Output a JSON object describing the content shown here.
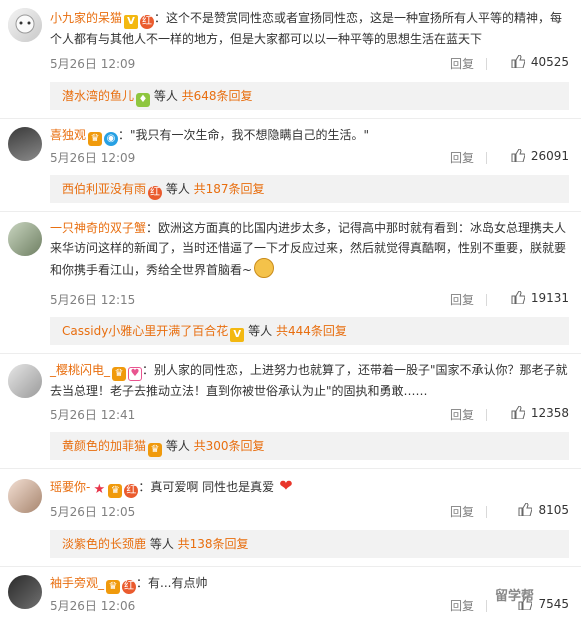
{
  "comments": [
    {
      "username": "小九家的呆猫",
      "text": "：这个不是赞赏同性恋或者宣扬同性恋，这是一种宣扬所有人平等的精神，每个人都有与其他人不一样的地方，但是大家都可以以一种平等的思想生活在蓝天下",
      "time": "5月26日 12:09",
      "reply_label": "回复",
      "likes": "40525",
      "replies": {
        "name": "潜水湾的鱼儿",
        "text": " 等人 ",
        "count": "共648条回复"
      }
    },
    {
      "username": "喜独观",
      "text": "：\"我只有一次生命，我不想隐瞒自己的生活。\"",
      "time": "5月26日 12:09",
      "reply_label": "回复",
      "likes": "26091",
      "replies": {
        "name": "西伯利亚没有雨",
        "text": " 等人 ",
        "count": "共187条回复"
      }
    },
    {
      "username": "一只神奇的双子蟹",
      "text": "：欧洲这方面真的比国内进步太多，记得高中那时就有看到：冰岛女总理携夫人来华访问这样的新闻了，当时还惜逼了一下才反应过来，然后就觉得真酷啊，性别不重要，朕就要和你携手看江山，秀给全世界首脑看~",
      "time": "5月26日 12:15",
      "reply_label": "回复",
      "likes": "19131",
      "replies": {
        "name": "Cassidy小雅心里开满了百合花",
        "text": " 等人 ",
        "count": "共444条回复"
      }
    },
    {
      "username": "_樱桃闪电_",
      "text": "：别人家的同性恋，上进努力也就算了，还带着一股子\"国家不承认你？那老子就去当总理！老子去推动立法！直到你被世俗承认为止\"的固执和勇敢……",
      "time": "5月26日 12:41",
      "reply_label": "回复",
      "likes": "12358",
      "replies": {
        "name": "黄颜色的加菲猫",
        "text": " 等人 ",
        "count": "共300条回复"
      }
    },
    {
      "username": "瑶要你-",
      "text": "：真可爱啊 同性也是真爱",
      "time": "5月26日 12:05",
      "reply_label": "回复",
      "likes": "8105",
      "replies": {
        "name": "淡紫色的长颈鹿",
        "text": " 等人 ",
        "count": "共138条回复"
      }
    },
    {
      "username": "袖手旁观_",
      "text": "：有...有点帅",
      "time": "5月26日 12:06",
      "reply_label": "回复",
      "likes": "7545"
    }
  ],
  "watermark": "留学帮",
  "colors": {
    "name": "#e86e0f",
    "meta": "#808080",
    "reply_bg": "#f2f2f2"
  }
}
